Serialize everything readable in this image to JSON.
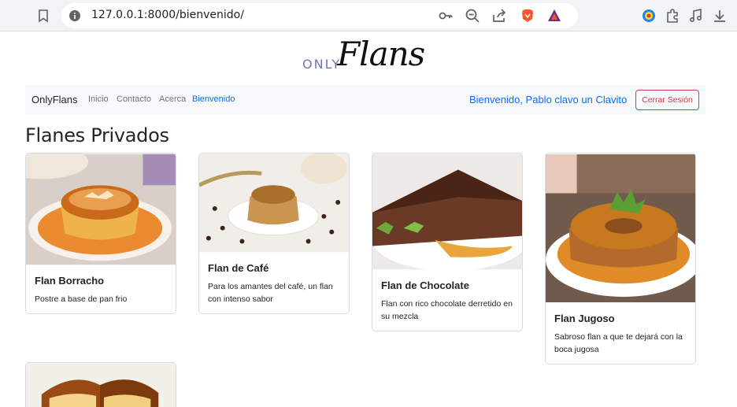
{
  "browser": {
    "url": "127.0.0.1:8000/bienvenido/"
  },
  "site": {
    "logo_small": "ONLY",
    "logo_script": "Flans"
  },
  "navbar": {
    "brand": "OnlyFlans",
    "links": [
      "Inicio",
      "Contacto",
      "Acerca",
      "Bienvenido"
    ],
    "welcome": "Bienvenido, Pablo clavo un Clavito",
    "logout": "Cerrar Sesión",
    "active_color": "#0d6efd",
    "logout_color": "#dc3545"
  },
  "main": {
    "title": "Flanes Privados",
    "cards": [
      {
        "title": "Flan Borracho",
        "text": "Postre a base de pan frio"
      },
      {
        "title": "Flan de Café",
        "text": "Para los amantes del café, un flan con intenso sabor"
      },
      {
        "title": "Flan de Chocolate",
        "text": "Flan con rico chocolate derretido en su mezcla"
      },
      {
        "title": "Flan Jugoso",
        "text": "Sabroso flan a que te dejará con la boca jugosa"
      }
    ]
  }
}
